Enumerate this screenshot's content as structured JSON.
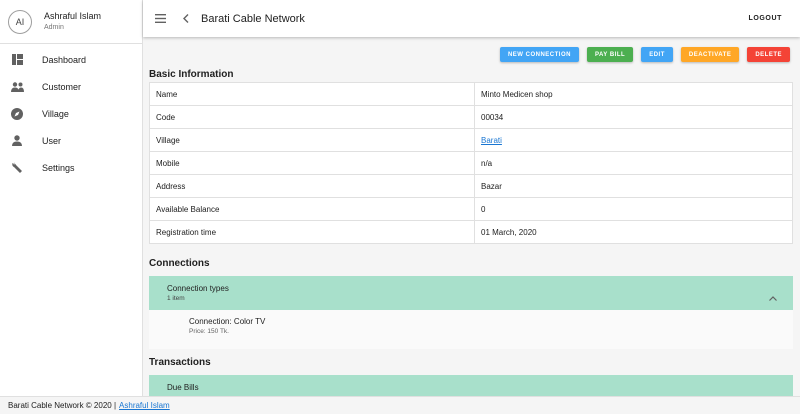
{
  "user": {
    "initials": "AI",
    "name": "Ashraful Islam",
    "role": "Admin"
  },
  "nav": [
    {
      "label": "Dashboard",
      "icon": "dashboard-icon"
    },
    {
      "label": "Customer",
      "icon": "people-icon"
    },
    {
      "label": "Village",
      "icon": "compass-icon"
    },
    {
      "label": "User",
      "icon": "person-icon"
    },
    {
      "label": "Settings",
      "icon": "wrench-icon"
    }
  ],
  "header": {
    "title": "Barati Cable Network",
    "logout": "LOGOUT"
  },
  "actions": [
    {
      "label": "NEW CONNECTION",
      "color": "#42a5f5"
    },
    {
      "label": "PAY BILL",
      "color": "#4caf50"
    },
    {
      "label": "EDIT",
      "color": "#42a5f5"
    },
    {
      "label": "DEACTIVATE",
      "color": "#ffa726"
    },
    {
      "label": "DELETE",
      "color": "#f44336"
    }
  ],
  "basic_info": {
    "title": "Basic Information",
    "rows": [
      {
        "label": "Name",
        "value": "Minto Medicen shop"
      },
      {
        "label": "Code",
        "value": "00034"
      },
      {
        "label": "Village",
        "value": "Barati"
      },
      {
        "label": "Mobile",
        "value": "n/a"
      },
      {
        "label": "Address",
        "value": "Bazar"
      },
      {
        "label": "Available Balance",
        "value": "0"
      },
      {
        "label": "Registration time",
        "value": "01 March, 2020"
      }
    ]
  },
  "connections": {
    "title": "Connections",
    "panel_title": "Connection types",
    "panel_sub": "1 item",
    "item_name": "Connection: Color TV",
    "item_price": "Price: 150 Tk."
  },
  "transactions": {
    "title": "Transactions",
    "panel_title": "Due Bills"
  },
  "footer": {
    "text": "Barati Cable Network © 2020 |",
    "link": "Ashraful Islam"
  },
  "colors": {
    "accent": "#1976d2",
    "panel": "#a8e0cb"
  }
}
